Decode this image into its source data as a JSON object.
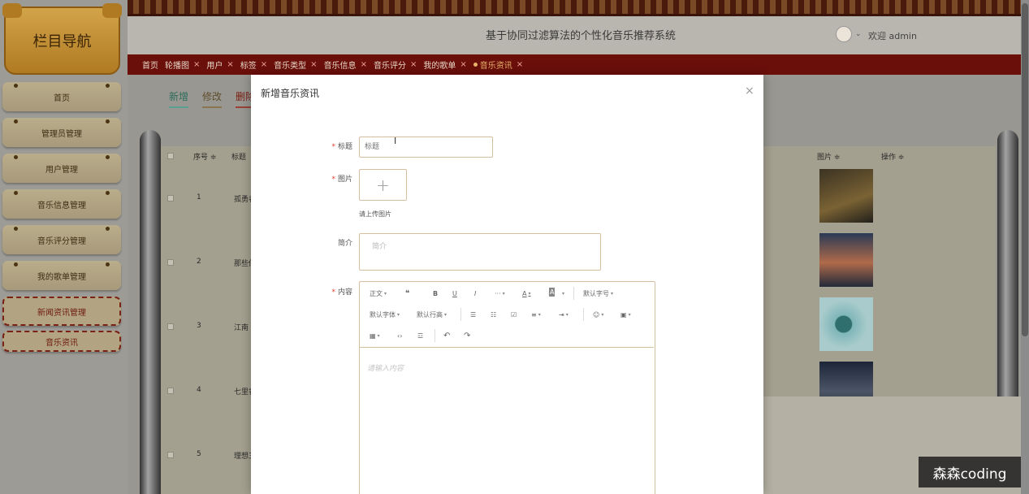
{
  "sidebar": {
    "title": "栏目导航",
    "items": [
      {
        "label": "首页"
      },
      {
        "label": "管理员管理"
      },
      {
        "label": "用户管理"
      },
      {
        "label": "音乐信息管理"
      },
      {
        "label": "音乐评分管理"
      },
      {
        "label": "我的歌单管理"
      },
      {
        "label": "新闻资讯管理"
      },
      {
        "label": "音乐资讯"
      }
    ]
  },
  "header": {
    "title": "基于协同过滤算法的个性化音乐推荐系统",
    "welcome": "欢迎 admin"
  },
  "tabs": [
    {
      "label": "首页"
    },
    {
      "label": "轮播图"
    },
    {
      "label": "用户"
    },
    {
      "label": "标签"
    },
    {
      "label": "音乐类型"
    },
    {
      "label": "音乐信息"
    },
    {
      "label": "音乐评分"
    },
    {
      "label": "我的歌单"
    },
    {
      "label": "音乐资讯"
    }
  ],
  "actions": {
    "add": "新增",
    "edit": "修改",
    "delete": "删除"
  },
  "table": {
    "headers": {
      "num": "序号 ≑",
      "title": "标题",
      "image": "图片 ≑",
      "ops": "操作 ≑"
    },
    "rows": [
      {
        "num": "1",
        "title": "孤勇者"
      },
      {
        "num": "2",
        "title": "那些你"
      },
      {
        "num": "3",
        "title": "江南"
      },
      {
        "num": "4",
        "title": "七里香"
      },
      {
        "num": "5",
        "title": "理想三"
      }
    ]
  },
  "modal": {
    "title": "新增音乐资讯",
    "close": "×",
    "fields": {
      "title_label": "标题",
      "title_placeholder": "标题",
      "image_label": "图片",
      "image_hint": "请上传图片",
      "intro_label": "简介",
      "intro_placeholder": "简介",
      "content_label": "内容",
      "required_mark": "*"
    },
    "editor": {
      "toolbar_row1": [
        "正文",
        "❝",
        "B",
        "U",
        "I",
        "···",
        "A",
        "A",
        "默认字号"
      ],
      "toolbar_row2": [
        "默认字体",
        "默认行高",
        "☰",
        "☷",
        "☑",
        "≡",
        "⇥",
        "☺",
        "▣"
      ],
      "toolbar_row3": [
        "▦",
        "‹›",
        "☲",
        "↶",
        "↷"
      ],
      "placeholder": "请输入内容"
    }
  },
  "watermark": "森森coding",
  "colors": {
    "brand_red": "#6b0f0a",
    "input_border": "#d5bf9f",
    "add_btn": "#2d6b5e",
    "required": "#e23c2b"
  }
}
